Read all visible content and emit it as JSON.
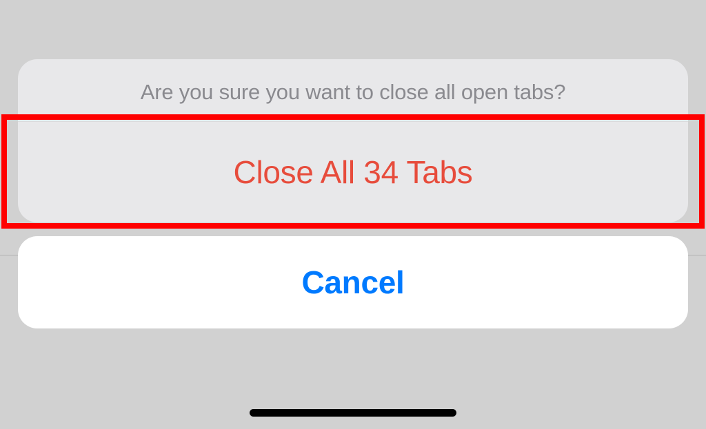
{
  "actionSheet": {
    "prompt": "Are you sure you want to close all open tabs?",
    "destructiveLabel": "Close All 34 Tabs",
    "cancelLabel": "Cancel"
  },
  "colors": {
    "destructive": "#e74c3c",
    "cancel": "#007aff",
    "highlight": "#ff0000"
  }
}
